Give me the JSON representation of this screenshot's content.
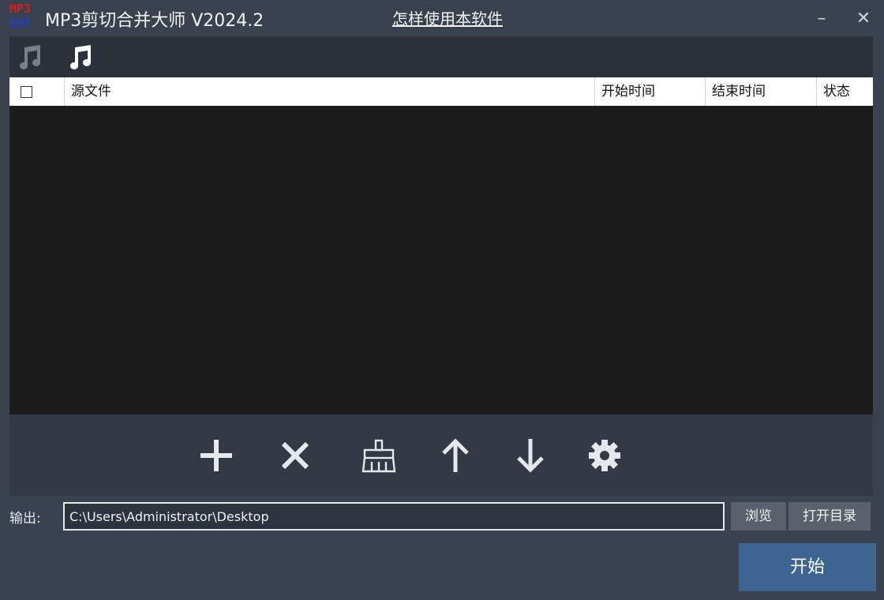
{
  "logo": {
    "line1": "MP3",
    "line2": "CUT"
  },
  "app_title": "MP3剪切合并大师 V2024.2",
  "help_link": "怎样使用本软件",
  "window_controls": {
    "minimize": "–",
    "close": "✕"
  },
  "mode_tabs": [
    {
      "name": "cut-mode",
      "icon": "music-note-icon",
      "active": false
    },
    {
      "name": "merge-mode",
      "icon": "music-notes-icon",
      "active": true
    }
  ],
  "table": {
    "columns": [
      "源文件",
      "开始时间",
      "结束时间",
      "状态"
    ],
    "rows": []
  },
  "actions": [
    {
      "name": "add-file-button",
      "icon": "plus-icon"
    },
    {
      "name": "remove-file-button",
      "icon": "x-icon"
    },
    {
      "name": "clear-list-button",
      "icon": "broom-icon"
    },
    {
      "name": "move-up-button",
      "icon": "arrow-up-icon"
    },
    {
      "name": "move-down-button",
      "icon": "arrow-down-icon"
    },
    {
      "name": "settings-button",
      "icon": "gear-icon"
    }
  ],
  "output": {
    "label": "输出:",
    "path": "C:\\Users\\Administrator\\Desktop",
    "browse_label": "浏览",
    "open_dir_label": "打开目录"
  },
  "start_label": "开始",
  "colors": {
    "window_bg": "#3a4250",
    "list_bg": "#1c1c1c",
    "start_button": "#3e6592",
    "logo_red": "#d21f1f",
    "logo_blue": "#1f3bd2"
  }
}
